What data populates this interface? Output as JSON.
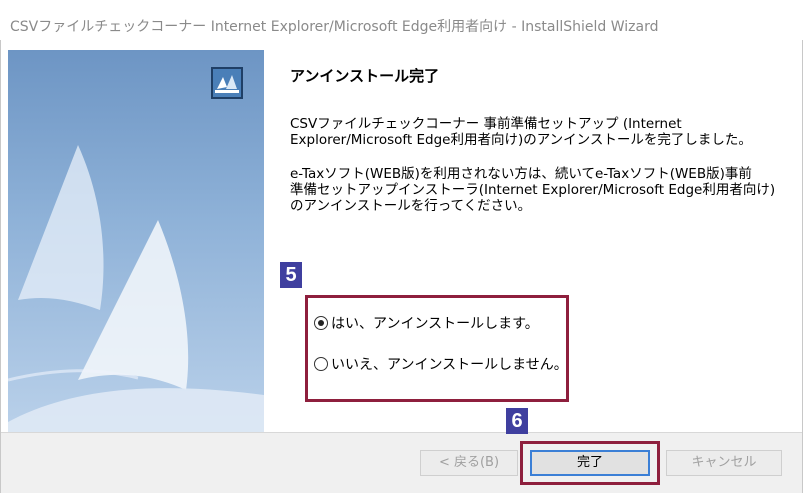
{
  "window": {
    "title": "CSVファイルチェックコーナー Internet Explorer/Microsoft Edge利用者向け - InstallShield Wizard"
  },
  "content": {
    "heading": "アンインストール完了",
    "paragraph1": "CSVファイルチェックコーナー 事前準備セットアップ (Internet\nExplorer/Microsoft Edge利用者向け)のアンインストールを完了しました。",
    "paragraph2": "e-Taxソフト(WEB版)を利用されない方は、続いてe-Taxソフト(WEB版)事前\n準備セットアップインストーラ(Internet Explorer/Microsoft Edge利用者向け)\nのアンインストールを行ってください。"
  },
  "options": [
    {
      "label": "はい、アンインストールします。",
      "selected": true
    },
    {
      "label": "いいえ、アンインストールしません。",
      "selected": false
    }
  ],
  "annotations": {
    "step5": "5",
    "step6": "6",
    "highlight_color": "#8e1f3d",
    "marker_color": "#3f3f9f"
  },
  "buttons": {
    "back": "< 戻る(B)",
    "finish": "完了",
    "cancel": "キャンセル"
  },
  "icons": {
    "setup": "installer-icon",
    "side_art": "sail-graphic"
  }
}
